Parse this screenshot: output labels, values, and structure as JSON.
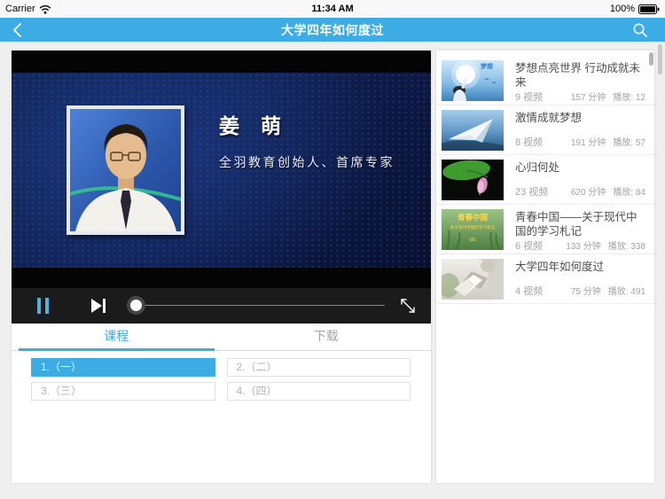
{
  "colors": {
    "accent": "#3bace4",
    "nav_bg": "#3bace4",
    "pause_icon": "#55aedc",
    "page_bg": "#efefef"
  },
  "status_bar": {
    "carrier": "Carrier",
    "time": "11:34 AM",
    "battery": "100%"
  },
  "nav_bar": {
    "title": "大学四年如何度过"
  },
  "player": {
    "speaker_name": "姜 萌",
    "speaker_title": "全羽教育创始人、首席专家"
  },
  "tabs": [
    {
      "label": "课程",
      "active": true
    },
    {
      "label": "下载",
      "active": false
    }
  ],
  "lessons": [
    {
      "label": "1.（一）",
      "active": true
    },
    {
      "label": "2.（二）",
      "active": false
    },
    {
      "label": "3.（三）",
      "active": false
    },
    {
      "label": "4.（四）",
      "active": false
    }
  ],
  "playlist": [
    {
      "title": "梦想点亮世界 行动成就未来",
      "videos": "9 视频",
      "duration": "157 分钟",
      "plays": "播放: 12",
      "thumb": "child-reaching-sky",
      "thumb_text": "梦想"
    },
    {
      "title": "激情成就梦想",
      "videos": "8 视频",
      "duration": "191 分钟",
      "plays": "播放: 57",
      "thumb": "paper-plane-sky",
      "thumb_text": ""
    },
    {
      "title": "心归何处",
      "videos": "23 视频",
      "duration": "620 分钟",
      "plays": "播放: 84",
      "thumb": "lotus-flower",
      "thumb_text": ""
    },
    {
      "title": "青春中国——关于现代中国的学习札记",
      "videos": "6 视频",
      "duration": "133 分钟",
      "plays": "播放: 338",
      "thumb": "green-grass-cover",
      "thumb_title": "青春中国",
      "thumb_sub": "关于现代中国的学习札记",
      "thumb_num": "（四）"
    },
    {
      "title": "大学四年如何度过",
      "videos": "4 视频",
      "duration": "75 分钟",
      "plays": "播放: 491",
      "thumb": "person-reading-book",
      "thumb_text": ""
    }
  ]
}
